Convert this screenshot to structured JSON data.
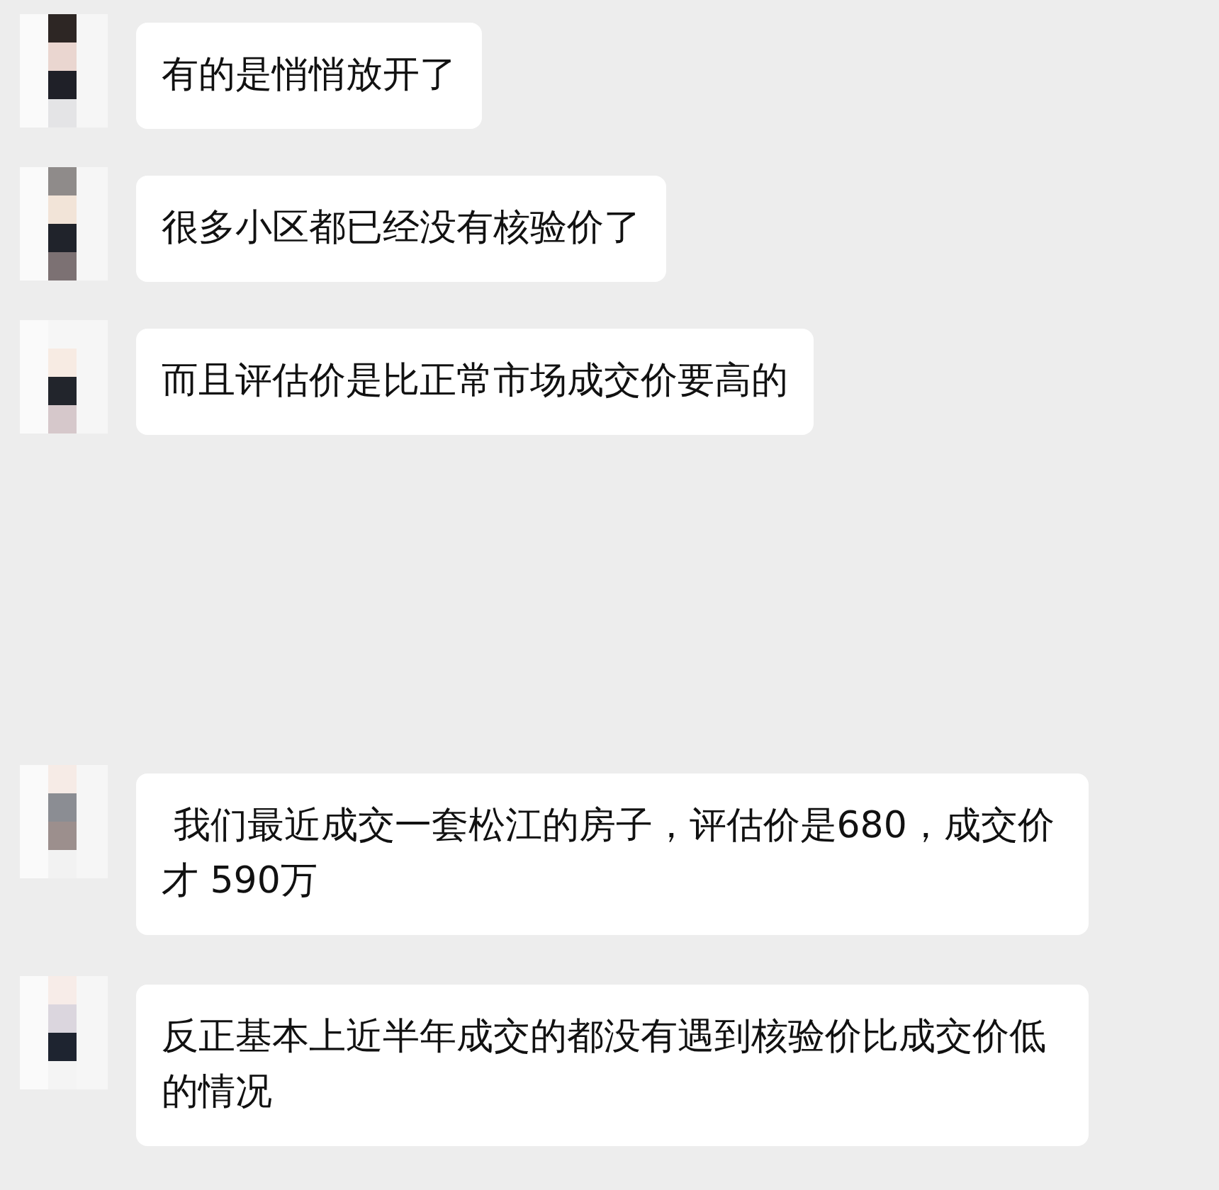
{
  "messages": [
    {
      "text": "有的是悄悄放开了"
    },
    {
      "text": "很多小区都已经没有核验价了"
    },
    {
      "text": "而且评估价是比正常市场成交价要高的"
    },
    {
      "text": " 我们最近成交一套松江的房子，评估价是680，成交价才 590万"
    },
    {
      "text": "反正基本上近半年成交的都没有遇到核验价比成交价低的情况"
    }
  ]
}
